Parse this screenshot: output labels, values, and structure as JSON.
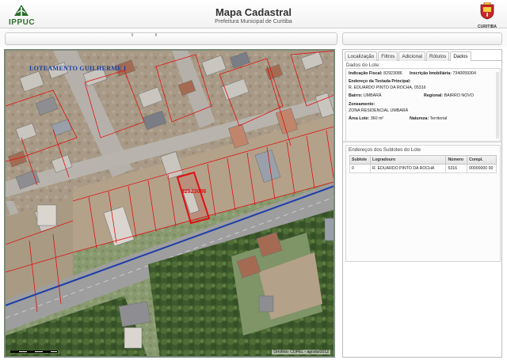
{
  "header": {
    "brand": "IPPUC",
    "title": "Mapa Cadastral",
    "subtitle": "Prefeitura Municipal de Curitiba",
    "city_logo_text": "CURITIBA"
  },
  "map": {
    "street_label": "LOTEAMENTO GUILHERME I",
    "lot_label": "82923086",
    "credit": "Ortofoto: COPEL - agosto/2012"
  },
  "panel": {
    "tabs": [
      {
        "label": "Localização",
        "active": false
      },
      {
        "label": "Filtros",
        "active": false
      },
      {
        "label": "Adicional",
        "active": false
      },
      {
        "label": "Rótulos",
        "active": false
      },
      {
        "label": "Dados",
        "active": true
      }
    ],
    "lot_section_title": "Dados do Lote:",
    "lot": {
      "fiscal_label": "Indicação Fiscal:",
      "fiscal_value": "82923086",
      "imob_label": "Inscrição Imobiliária:",
      "imob_value": "7340059304",
      "address_label": "Endereço da Testada Principal:",
      "address_value": "R. EDUARDO PINTO DA ROCHA, 05316",
      "bairro_label": "Bairro:",
      "bairro_value": "UMBARÁ",
      "regional_label": "Regional:",
      "regional_value": "BAIRRO NOVO",
      "zone_label": "Zoneamento:",
      "zone_value": "ZONA RESIDENCIAL UMBARÁ",
      "area_label": "Área Lote:",
      "area_value": "360 m²",
      "nature_label": "Natureza:",
      "nature_value": "Territorial"
    },
    "sublots_title": "Endereços dos Sublotes do Lote",
    "sublots_columns": [
      "Sublote",
      "Logradouro",
      "Número",
      "Compl."
    ],
    "sublots_rows": [
      {
        "sublote": "0",
        "logradouro": "R. EDUARDO PINTO DA ROCHA",
        "numero": "5316",
        "compl": "00000000 00"
      }
    ]
  },
  "colors": {
    "lot_outline": "#e01010",
    "road_line": "#1d3fa8",
    "ippuc_green": "#2c6f2c"
  }
}
